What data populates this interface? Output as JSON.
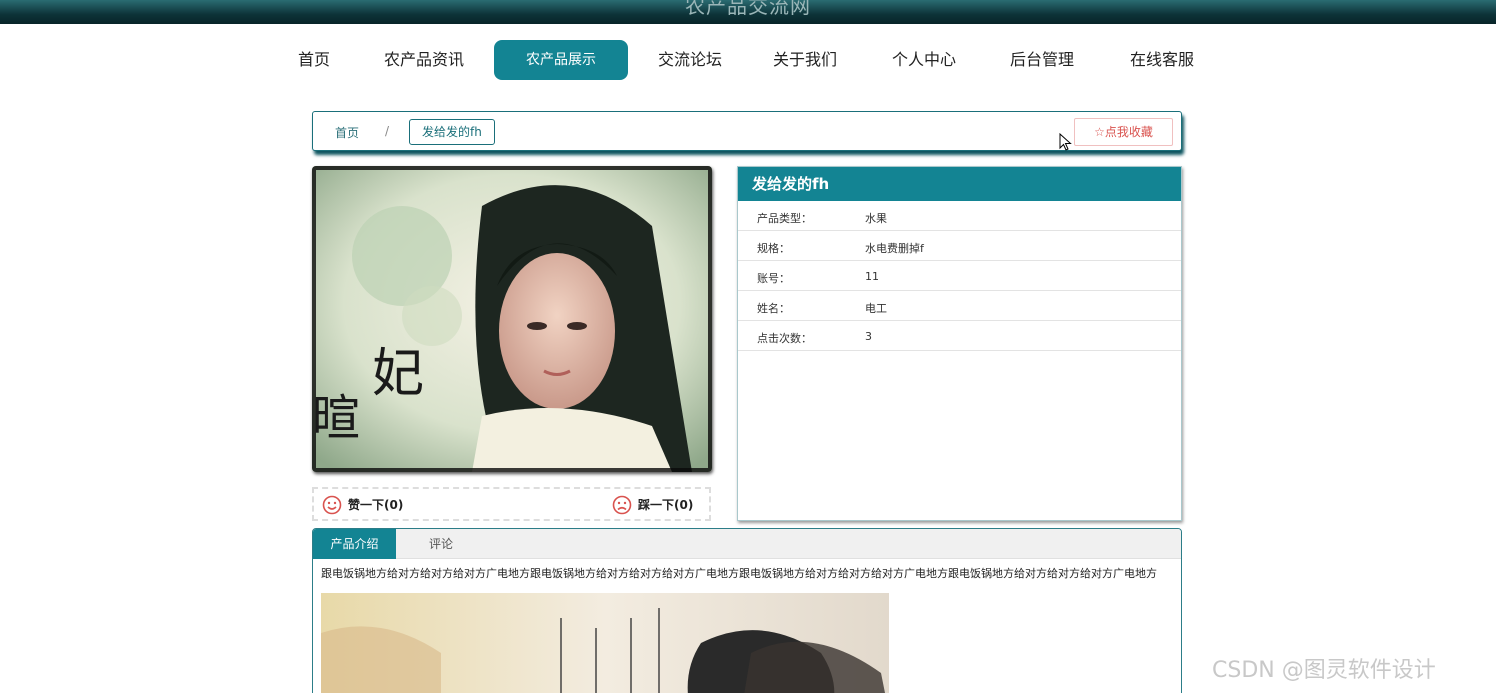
{
  "site": {
    "title": "农产品交流网"
  },
  "nav": {
    "items": [
      {
        "label": "首页"
      },
      {
        "label": "农产品资讯"
      },
      {
        "label": "农产品展示",
        "active": true
      },
      {
        "label": "交流论坛"
      },
      {
        "label": "关于我们"
      },
      {
        "label": "个人中心"
      },
      {
        "label": "后台管理"
      },
      {
        "label": "在线客服"
      }
    ]
  },
  "breadcrumb": {
    "home": "首页",
    "separator": "/",
    "current": "发给发的fh"
  },
  "favorite": {
    "label": "点我收藏",
    "icon": "star-outline-icon"
  },
  "product": {
    "name": "发给发的fh",
    "fields": [
      {
        "label": "产品类型：",
        "value": "水果"
      },
      {
        "label": "规格：",
        "value": "水电费删掉f"
      },
      {
        "label": "账号：",
        "value": "11"
      },
      {
        "label": "姓名：",
        "value": "电工"
      },
      {
        "label": "点击次数：",
        "value": "3"
      }
    ],
    "image_caption_chars": "妃暄"
  },
  "votes": {
    "like": {
      "label": "赞一下(0)",
      "icon": "smile-icon"
    },
    "dislike": {
      "label": "踩一下(0)",
      "icon": "frown-icon"
    }
  },
  "tabs": {
    "items": [
      {
        "label": "产品介绍",
        "active": true
      },
      {
        "label": "评论"
      }
    ]
  },
  "intro": {
    "text": "跟电饭锅地方给对方给对方给对方广电地方跟电饭锅地方给对方给对方给对方广电地方跟电饭锅地方给对方给对方给对方广电地方跟电饭锅地方给对方给对方给对方广电地方"
  },
  "watermark": "CSDN @图灵软件设计",
  "colors": {
    "accent": "#138493",
    "header_dark": "#0d3338",
    "favorite": "#d9534f"
  }
}
